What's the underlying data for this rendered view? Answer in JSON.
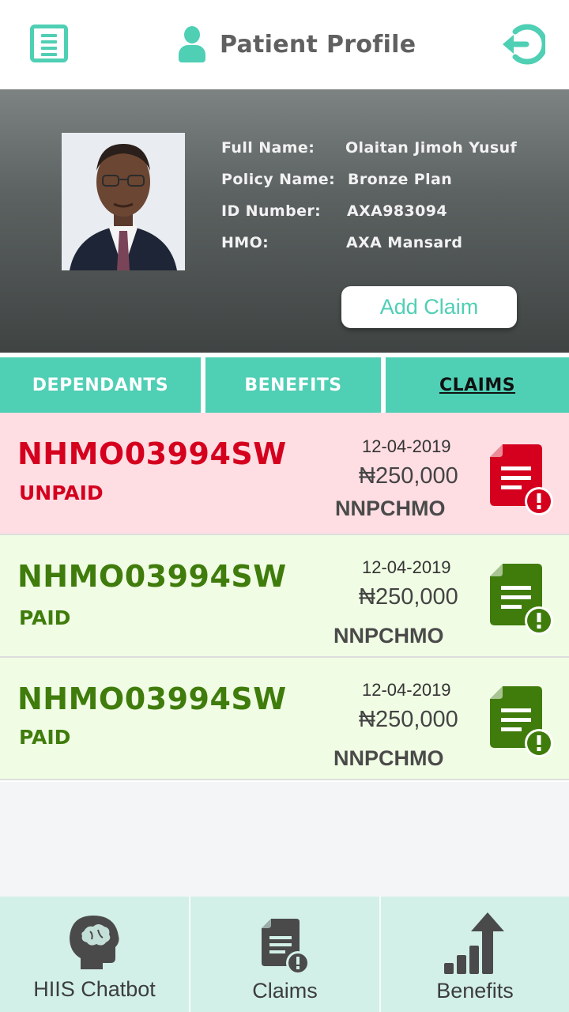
{
  "header": {
    "title": "Patient Profile",
    "accent_color": "#4fcfb4",
    "menu_icon": "list-icon",
    "user_icon": "person-icon",
    "logout_icon": "logout-icon"
  },
  "profile": {
    "photo": "patient-photo",
    "fields": [
      {
        "label": "Full Name:",
        "value": "Olaitan Jimoh Yusuf"
      },
      {
        "label": "Policy Name:",
        "value": "Bronze Plan"
      },
      {
        "label": "ID Number:",
        "value": "AXA983094"
      },
      {
        "label": "HMO:",
        "value": "AXA Mansard"
      }
    ],
    "add_claim_label": "Add Claim"
  },
  "tabs": [
    {
      "label": "DEPENDANTS",
      "active": false
    },
    {
      "label": "BENEFITS",
      "active": false
    },
    {
      "label": "CLAIMS",
      "active": true
    }
  ],
  "claims": [
    {
      "id": "NHMO03994SW",
      "status": "UNPAID",
      "date": "12-04-2019",
      "amount": "₦250,000",
      "hmo": "NNPCHMO",
      "status_color": "#d4001e"
    },
    {
      "id": "NHMO03994SW",
      "status": "PAID",
      "date": "12-04-2019",
      "amount": "₦250,000",
      "hmo": "NNPCHMO",
      "status_color": "#3f7c0c"
    },
    {
      "id": "NHMO03994SW",
      "status": "PAID",
      "date": "12-04-2019",
      "amount": "₦250,000",
      "hmo": "NNPCHMO",
      "status_color": "#3f7c0c"
    }
  ],
  "bottom_nav": [
    {
      "label": "HIIS Chatbot",
      "icon": "brain-head-icon"
    },
    {
      "label": "Claims",
      "icon": "claims-doc-icon"
    },
    {
      "label": "Benefits",
      "icon": "bar-chart-arrow-icon"
    }
  ]
}
